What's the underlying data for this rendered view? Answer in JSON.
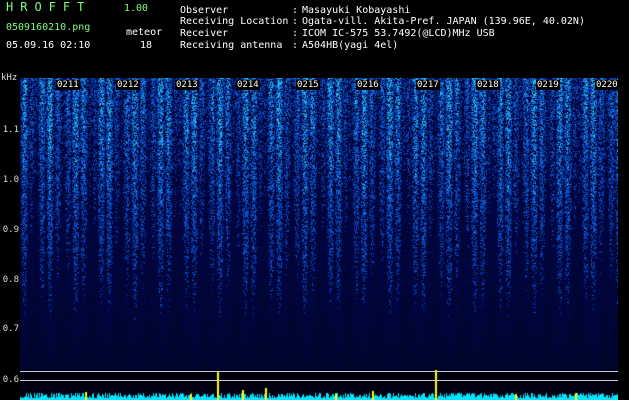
{
  "header": {
    "app_name": "HROFFT",
    "version": "1.00",
    "filename": "0509160210.png",
    "datetime": "05.09.16 02:10",
    "meteor_label": "meteor",
    "meteor_count": "18"
  },
  "info": [
    {
      "key": "Observer",
      "value": "Masayuki Kobayashi"
    },
    {
      "key": "Receiving Location",
      "value": "Ogata-vill. Akita-Pref. JAPAN (139.96E, 40.02N)"
    },
    {
      "key": "Receiver",
      "value": "ICOM IC-575 53.7492(@LCD)MHz USB"
    },
    {
      "key": "Receiving antenna",
      "value": "A504HB(yagi 4el)"
    }
  ],
  "axis": {
    "unit": "kHz",
    "yticks": [
      "1.1",
      "1.0",
      "0.9",
      "0.8",
      "0.7",
      "0.6"
    ],
    "time_labels": [
      "0211",
      "0212",
      "0213",
      "0214",
      "0215",
      "0216",
      "0217",
      "0218",
      "0219",
      "0220"
    ]
  },
  "colors": {
    "background": "#000000",
    "spectrum": "#1030c0",
    "baseline": "#00ffff",
    "meteor": "#ffff00"
  }
}
